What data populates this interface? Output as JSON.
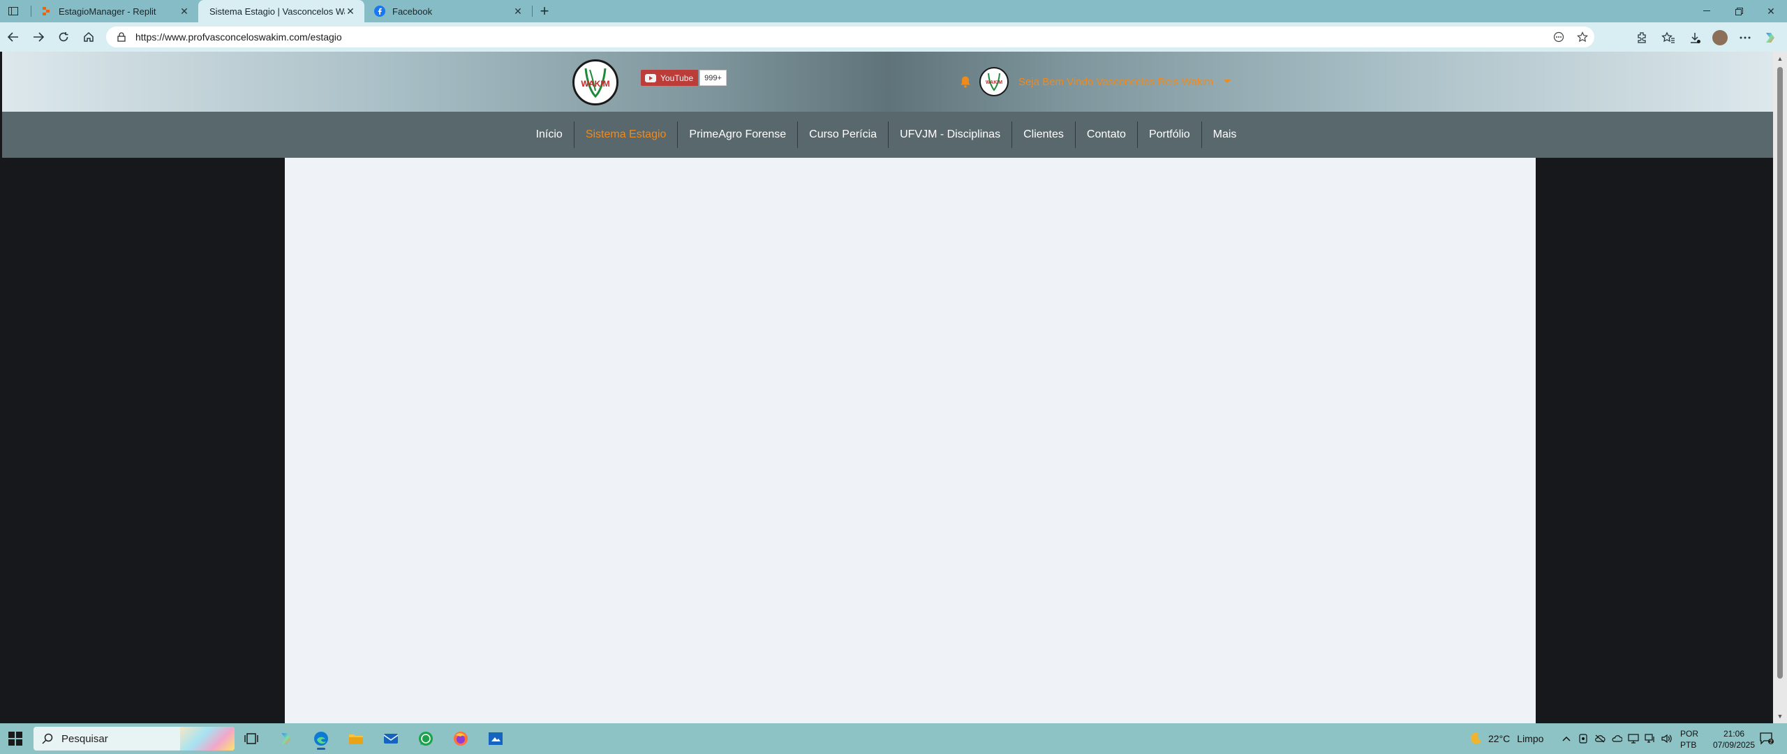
{
  "browser": {
    "tabs": [
      {
        "label": "EstagioManager - Replit",
        "favicon": "replit-icon",
        "active": false
      },
      {
        "label": "Sistema Estagio | Vasconcelos Wa",
        "favicon": "none",
        "active": true
      },
      {
        "label": "Facebook",
        "favicon": "facebook-icon",
        "active": false
      }
    ],
    "url": "https://www.profvasconceloswakim.com/estagio"
  },
  "site": {
    "logo_text": "WAKIM",
    "youtube": {
      "label": "YouTube",
      "count": "999+"
    },
    "welcome": "Seja Bem Vindo Vasconcelos Reis Wakim",
    "nav": [
      {
        "label": "Início",
        "active": false
      },
      {
        "label": "Sistema Estagio",
        "active": true
      },
      {
        "label": "PrimeAgro Forense",
        "active": false
      },
      {
        "label": "Curso Perícia",
        "active": false
      },
      {
        "label": "UFVJM - Disciplinas",
        "active": false
      },
      {
        "label": "Clientes",
        "active": false
      },
      {
        "label": "Contato",
        "active": false
      },
      {
        "label": "Portfólio",
        "active": false
      },
      {
        "label": "Mais",
        "active": false
      }
    ],
    "accent_color": "#f08a1c"
  },
  "taskbar": {
    "search_placeholder": "Pesquisar",
    "weather": {
      "temp": "22°C",
      "condition": "Limpo"
    },
    "lang_top": "POR",
    "lang_bottom": "PTB",
    "time": "21:06",
    "date": "07/09/2025",
    "notification_count": "2"
  }
}
